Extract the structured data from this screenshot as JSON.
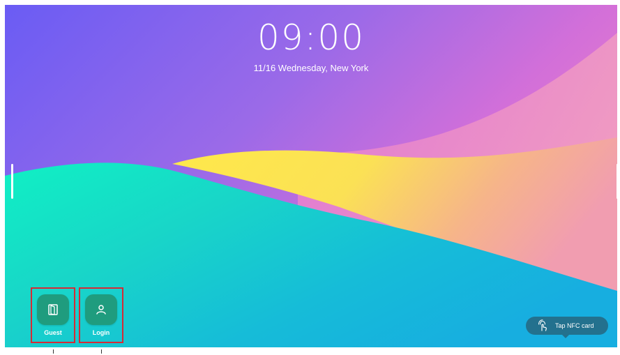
{
  "lock_screen": {
    "time": "09:00",
    "date_location": "11/16 Wednesday, New York"
  },
  "quick_apps": [
    {
      "label": "Guest",
      "icon": "door-icon"
    },
    {
      "label": "Login",
      "icon": "user-icon"
    }
  ],
  "nfc": {
    "label": "Tap NFC card",
    "icon": "nfc-tap-icon"
  },
  "colors": {
    "accent_tile": "#1f9c7e",
    "highlight_box": "#d62a35",
    "nfc_pill": "#23718e"
  }
}
